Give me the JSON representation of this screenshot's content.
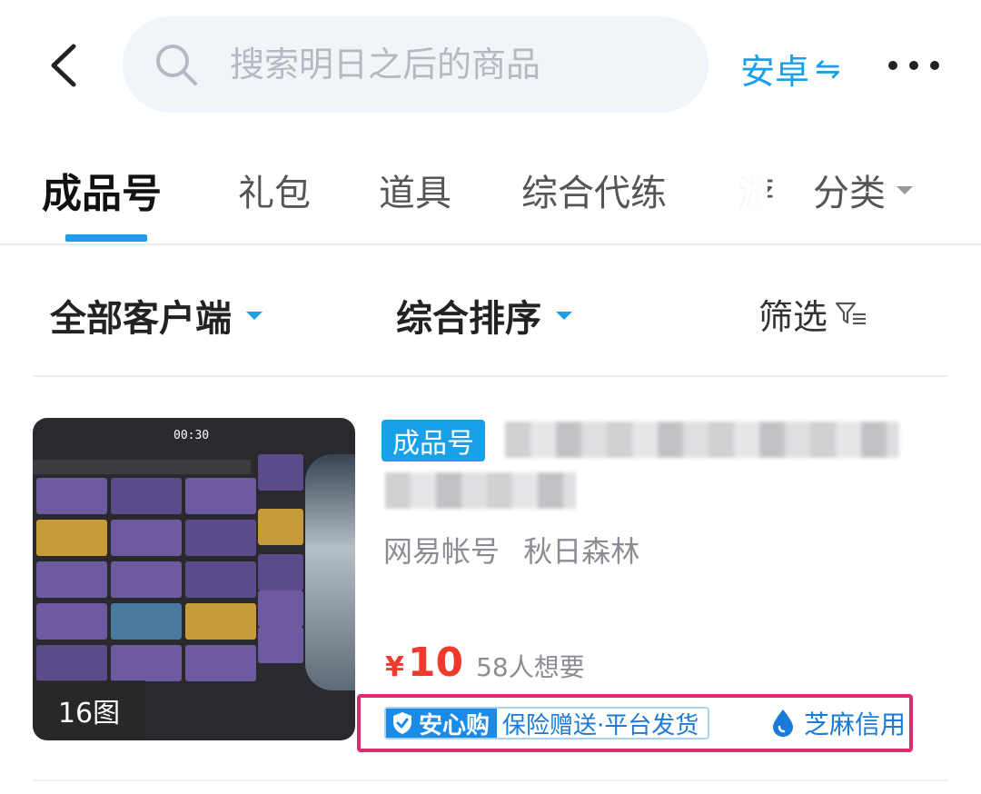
{
  "search": {
    "placeholder": "搜索明日之后的商品"
  },
  "platform": {
    "label": "安卓",
    "swap_symbol": "⇋"
  },
  "tabs": [
    {
      "label": "成品号",
      "active": true
    },
    {
      "label": "礼包"
    },
    {
      "label": "道具"
    },
    {
      "label": "综合代练"
    },
    {
      "label": "游"
    }
  ],
  "category_tab": {
    "label": "分类"
  },
  "filters": {
    "client": "全部客户端",
    "sort": "综合排序",
    "screen": "筛选"
  },
  "listing": {
    "image_count": "16图",
    "thumb_timer": "00:30",
    "badge": "成品号",
    "account_type": "网易帐号",
    "server": "秋日森林",
    "currency": "¥",
    "price": "10",
    "want_count": "58人想要",
    "safe_badge": "安心购",
    "safe_text": "保险赠送·平台发货",
    "credit_tag": "芝麻信用"
  },
  "colors": {
    "accent": "#1aa0e8",
    "price": "#f03a2e",
    "highlight_border": "#e02a74"
  }
}
